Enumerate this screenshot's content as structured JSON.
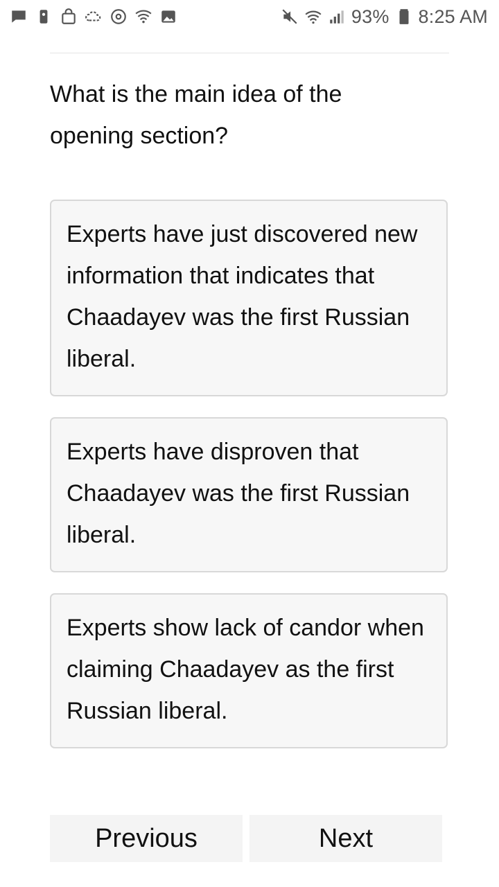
{
  "status_bar": {
    "left_icons": [
      "message-icon",
      "phone-lock-icon",
      "bag-icon",
      "cloud-sync-icon",
      "at-sign-icon",
      "wifi-call-icon",
      "image-icon"
    ],
    "right_icons": [
      "mute-icon",
      "wifi-icon",
      "signal-icon",
      "battery-icon"
    ],
    "battery": "93%",
    "time": "8:25 AM"
  },
  "quiz": {
    "question": "What is the main idea of the opening section?",
    "options": [
      "Experts have just discovered new information that indicates that Chaadayev was the first Russian liberal.",
      "Experts have disproven that Chaadayev was the first Russian liberal.",
      "Experts show lack of candor when claiming Chaadayev as the first Russian liberal."
    ]
  },
  "navigation": {
    "previous_label": "Previous",
    "next_label": "Next"
  }
}
